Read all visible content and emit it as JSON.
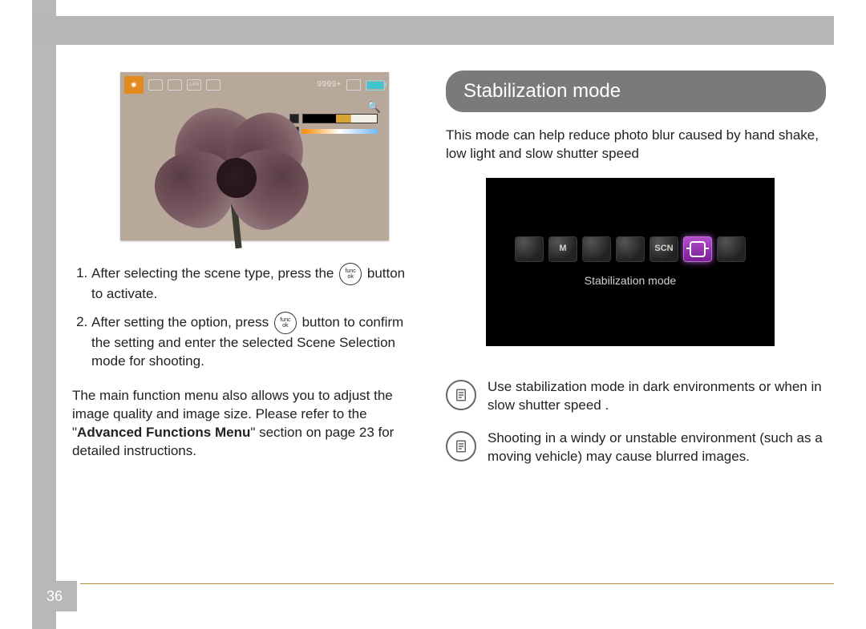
{
  "page_number": "36",
  "left": {
    "lcd": {
      "counter": "9999+",
      "size_label": "14M"
    },
    "steps": [
      {
        "pre": "After selecting the scene type, press the ",
        "post": " button to activate."
      },
      {
        "pre": "After setting the option, press ",
        "post": " button to confirm the setting and enter the selected Scene Selection mode for shooting."
      }
    ],
    "func_btn_top": "func",
    "func_btn_bot": "ok",
    "para_pre": "The main function menu also allows you to adjust the image quality and image size. Please refer to the \"",
    "para_bold": "Advanced Functions Menu",
    "para_post": "\" section on page 23 for detailed instructions."
  },
  "right": {
    "title": "Stabilization mode",
    "intro": "This mode can help reduce photo blur caused by hand shake, low light and slow shutter speed",
    "menu": {
      "modes": [
        "",
        "M",
        "",
        "",
        "SCN",
        "",
        ""
      ],
      "selected_index": 5,
      "label": "Stabilization mode"
    },
    "notes": [
      "Use stabilization mode in dark environments or when in slow shutter speed .",
      "Shooting in a windy or unstable environment (such as a moving vehicle) may cause blurred images."
    ]
  }
}
